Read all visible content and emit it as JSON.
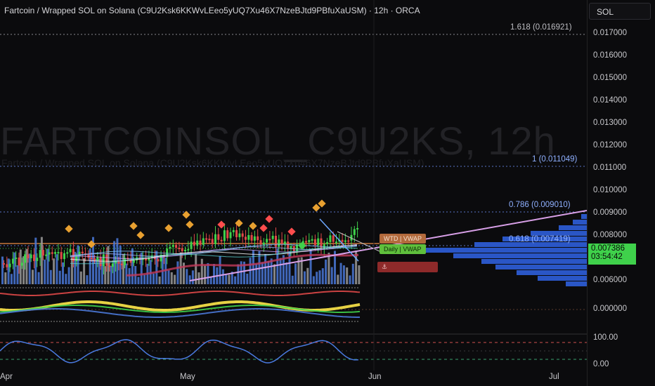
{
  "header": {
    "title": "Fartcoin / Wrapped SOL on Solana (C9U2Ksk6KKWvLEeo5yUQ7Xu46X7NzeBJtd9PBfuXaUSM) · 12h · ORCA"
  },
  "watermark": {
    "symbol": "FARTCOINSOL_C9U2KS, 12h",
    "subtitle": "Fartcoin / Wrapped SOL on Solana (C9U2Ksk6KKWvLEeo5yUQ7Xu46X7NzeBJtd9PBfuXaUSM)"
  },
  "symbol_search": {
    "value": "SOL"
  },
  "price_axis": {
    "ticks": [
      "0.017000",
      "0.016000",
      "0.015000",
      "0.014000",
      "0.013000",
      "0.012000",
      "0.011000",
      "0.010000",
      "0.009000",
      "0.008000",
      "0.006000"
    ],
    "indicator_tick": "0.000000",
    "oscillator_ticks": [
      "100.00",
      "0.00"
    ]
  },
  "fib_levels": [
    {
      "label": "1.618 (0.016921)",
      "color": "#bdbdc2"
    },
    {
      "label": "1 (0.011049)",
      "color": "#8fb0ff"
    },
    {
      "label": "0.786 (0.009010)",
      "color": "#8fb0ff"
    },
    {
      "label": "0.618 (0.007419)",
      "color": "#8fb0ff"
    }
  ],
  "current_price": {
    "value": "0.007386",
    "countdown": "03:54:42",
    "color": "#3fd14b"
  },
  "time_axis": {
    "ticks": [
      "Apr",
      "May",
      "Jun",
      "Jul"
    ]
  },
  "chips": {
    "wtd_vwap": "WTD | VWAP",
    "daily_vwap": "Daily | VWAP",
    "anchor": "⚓"
  },
  "colors": {
    "background": "#0b0b0d",
    "accent": "#3fd14b",
    "volume_profile": "#2a56c6",
    "trendline": "#d8a0e8"
  }
}
